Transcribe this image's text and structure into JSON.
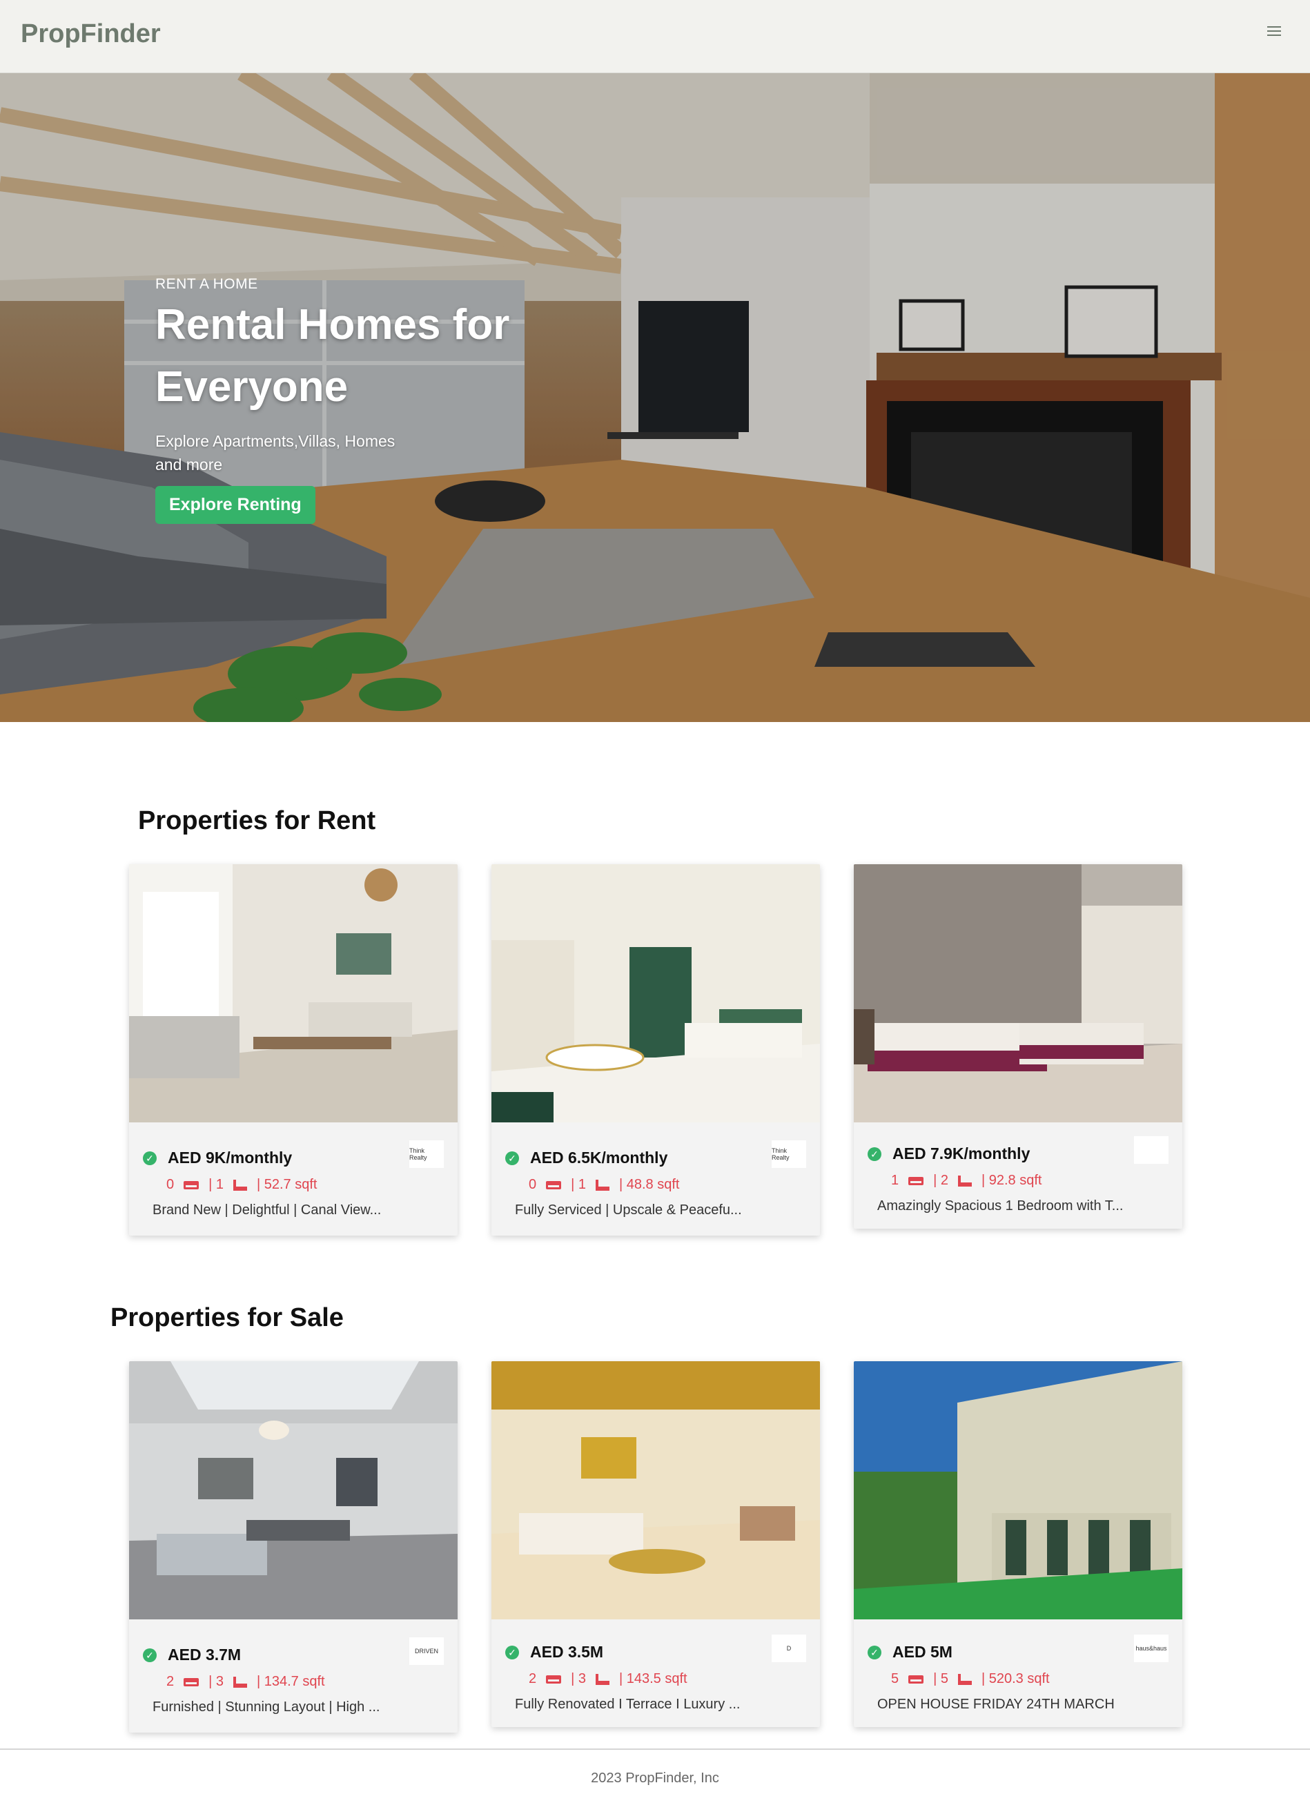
{
  "navbar": {
    "brand": "PropFinder",
    "menu_icon": "hamburger-icon"
  },
  "hero": {
    "kicker": "RENT A HOME",
    "title": "Rental Homes for Everyone",
    "subtitle": "Explore Apartments,Villas, Homes and more",
    "button": "Explore Renting"
  },
  "rent": {
    "title": "Properties for Rent",
    "cards": [
      {
        "price": "AED 9K/monthly",
        "beds": "0",
        "baths": "| 1",
        "area": "| 52.7 sqft",
        "desc": "Brand New | Delightful | Canal View...",
        "logo": "Think Realty"
      },
      {
        "price": "AED 6.5K/monthly",
        "beds": "0",
        "baths": "| 1",
        "area": "| 48.8 sqft",
        "desc": "Fully Serviced | Upscale & Peacefu...",
        "logo": "Think Realty"
      },
      {
        "price": "AED 7.9K/monthly",
        "beds": "1",
        "baths": "| 2",
        "area": "| 92.8 sqft",
        "desc": "Amazingly Spacious 1 Bedroom with T...",
        "logo": ""
      }
    ]
  },
  "sale": {
    "title": "Properties for Sale",
    "cards": [
      {
        "price": "AED 3.7M",
        "beds": "2",
        "baths": "| 3",
        "area": "| 134.7 sqft",
        "desc": "Furnished | Stunning Layout | High ...",
        "logo": "DRIVEN"
      },
      {
        "price": "AED 3.5M",
        "beds": "2",
        "baths": "| 3",
        "area": "| 143.5 sqft",
        "desc": "Fully Renovated I Terrace I Luxury ...",
        "logo": "D"
      },
      {
        "price": "AED 5M",
        "beds": "5",
        "baths": "| 5",
        "area": "| 520.3 sqft",
        "desc": "OPEN HOUSE FRIDAY 24TH MARCH",
        "logo": "haus&haus"
      }
    ]
  },
  "footer": {
    "text": "2023 PropFinder, Inc"
  },
  "colors": {
    "accent": "#35b36a",
    "meta": "#e0454f",
    "brand": "#6e7a6e"
  }
}
